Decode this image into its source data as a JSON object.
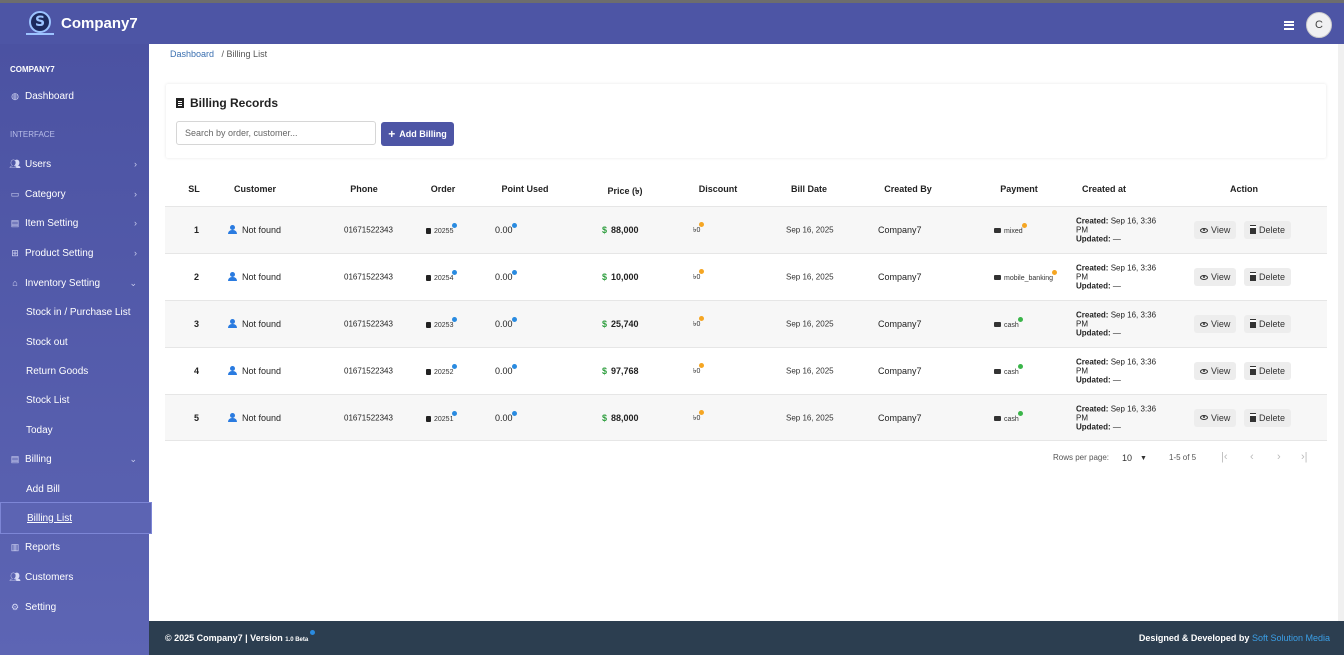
{
  "app": {
    "brand": "Company7",
    "avatar_initial": "C"
  },
  "sidebar": {
    "company": "COMPANY7",
    "dashboard": "Dashboard",
    "section_interface": "INTERFACE",
    "items": [
      {
        "label": "Users"
      },
      {
        "label": "Category"
      },
      {
        "label": "Item Setting"
      },
      {
        "label": "Product Setting"
      },
      {
        "label": "Inventory Setting"
      }
    ],
    "inventory_sub": [
      "Stock in / Purchase List",
      "Stock out",
      "Return Goods",
      "Stock List",
      "Today"
    ],
    "billing": "Billing",
    "billing_sub": [
      "Add Bill",
      "Billing List"
    ],
    "reports": "Reports",
    "customers": "Customers",
    "setting": "Setting"
  },
  "breadcrumb": {
    "home": "Dashboard",
    "current": "/ Billing List"
  },
  "card": {
    "title": "Billing Records",
    "search_placeholder": "Search by order, customer...",
    "add_button": "Add Billing"
  },
  "table": {
    "headers": {
      "sl": "SL",
      "customer": "Customer",
      "phone": "Phone",
      "order": "Order",
      "point": "Point Used",
      "price": "Price (৳)",
      "discount": "Discount",
      "bill_date": "Bill Date",
      "created_by": "Created By",
      "payment": "Payment",
      "created_at": "Created at",
      "action": "Action"
    },
    "rows": [
      {
        "sl": "1",
        "customer": "Not found",
        "phone": "01671522343",
        "order": "20255",
        "point": "0.00",
        "price": "88,000",
        "discount": "৳0",
        "bill_date": "Sep 16, 2025",
        "created_by": "Company7",
        "payment": "mixed",
        "payment_color": "#f5a623",
        "created": "Sep 16, 3:36",
        "created_pm": "PM",
        "updated": "—"
      },
      {
        "sl": "2",
        "customer": "Not found",
        "phone": "01671522343",
        "order": "20254",
        "point": "0.00",
        "price": "10,000",
        "discount": "৳0",
        "bill_date": "Sep 16, 2025",
        "created_by": "Company7",
        "payment": "mobile_banking",
        "payment_color": "#f5a623",
        "created": "Sep 16, 3:36",
        "created_pm": "PM",
        "updated": "—"
      },
      {
        "sl": "3",
        "customer": "Not found",
        "phone": "01671522343",
        "order": "20253",
        "point": "0.00",
        "price": "25,740",
        "discount": "৳0",
        "bill_date": "Sep 16, 2025",
        "created_by": "Company7",
        "payment": "cash",
        "payment_color": "#3bb54a",
        "created": "Sep 16, 3:36",
        "created_pm": "PM",
        "updated": "—"
      },
      {
        "sl": "4",
        "customer": "Not found",
        "phone": "01671522343",
        "order": "20252",
        "point": "0.00",
        "price": "97,768",
        "discount": "৳0",
        "bill_date": "Sep 16, 2025",
        "created_by": "Company7",
        "payment": "cash",
        "payment_color": "#3bb54a",
        "created": "Sep 16, 3:36",
        "created_pm": "PM",
        "updated": "—"
      },
      {
        "sl": "5",
        "customer": "Not found",
        "phone": "01671522343",
        "order": "20251",
        "point": "0.00",
        "price": "88,000",
        "discount": "৳0",
        "bill_date": "Sep 16, 2025",
        "created_by": "Company7",
        "payment": "cash",
        "payment_color": "#3bb54a",
        "created": "Sep 16, 3:36",
        "created_pm": "PM",
        "updated": "—"
      }
    ],
    "labels": {
      "created": "Created:",
      "updated": "Updated:",
      "view": "View",
      "delete": "Delete"
    }
  },
  "pagination": {
    "rows_per_page_label": "Rows per page:",
    "rows_per_page": "10",
    "range": "1-5 of 5"
  },
  "footer": {
    "left": "© 2025 Company7 | Version",
    "version": "1.0 Beta",
    "right_prefix": "Designed & Developed by",
    "right_link": "Soft Solution Media"
  },
  "colors": {
    "primary": "#4d55a5",
    "footer": "#2c3e50",
    "link": "#3b9fe6"
  }
}
